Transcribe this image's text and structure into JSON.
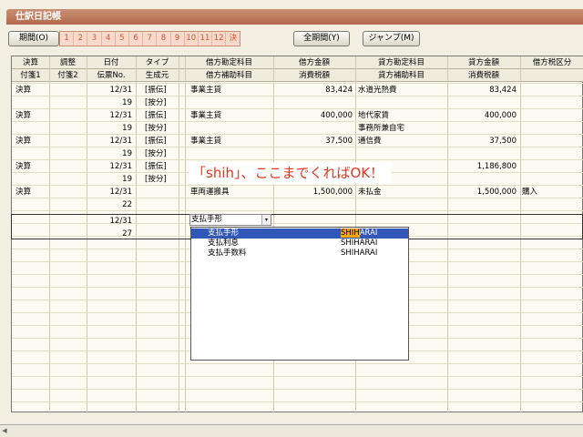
{
  "window_title": "仕訳日記帳",
  "toolbar": {
    "period_label": "期間(O)",
    "periods": [
      "1",
      "2",
      "3",
      "4",
      "5",
      "6",
      "7",
      "8",
      "9",
      "10",
      "11",
      "12",
      "決"
    ],
    "all_period_label": "全期間(Y)",
    "jump_label": "ジャンプ(M)"
  },
  "columns_top": [
    "決算",
    "調整",
    "日付",
    "タイプ",
    "借方勘定科目",
    "借方金額",
    "貸方勘定科目",
    "貸方金額",
    "借方税区分"
  ],
  "columns_bottom": [
    "付箋1",
    "付箋2",
    "伝票No.",
    "生成元",
    "借方補助科目",
    "消費税額",
    "貸方補助科目",
    "消費税額"
  ],
  "rows": [
    {
      "kessan": "決算",
      "date": "12/31",
      "no": "19",
      "type1": "[振伝]",
      "type2": "[按分]",
      "debit": "事業主貸",
      "debit_amt": "83,424",
      "credit": "水道光熱費",
      "credit_sub": "",
      "credit_amt": "83,424",
      "tax": ""
    },
    {
      "kessan": "決算",
      "date": "12/31",
      "no": "19",
      "type1": "[振伝]",
      "type2": "[按分]",
      "debit": "事業主貸",
      "debit_amt": "400,000",
      "credit": "地代家賃",
      "credit_sub": "事務所兼自宅",
      "credit_amt": "400,000",
      "tax": ""
    },
    {
      "kessan": "決算",
      "date": "12/31",
      "no": "19",
      "type1": "[振伝]",
      "type2": "[按分]",
      "debit": "事業主貸",
      "debit_amt": "37,500",
      "credit": "通信費",
      "credit_sub": "",
      "credit_amt": "37,500",
      "tax": ""
    },
    {
      "kessan": "決算",
      "date": "12/31",
      "no": "19",
      "type1": "[振伝]",
      "type2": "[按分]",
      "debit": "",
      "debit_amt": "",
      "credit": "",
      "credit_sub": "",
      "credit_amt": "1,186,800",
      "tax": ""
    },
    {
      "kessan": "決算",
      "date": "12/31",
      "no": "22",
      "type1": "",
      "type2": "",
      "debit": "車両運搬具",
      "debit_amt": "1,500,000",
      "credit": "未払金",
      "credit_sub": "",
      "credit_amt": "1,500,000",
      "tax": "購入"
    }
  ],
  "edit_row": {
    "date": "12/31",
    "no": "27",
    "combo_value": "支払手形"
  },
  "banner_text": "「shih」、ここまでくればOK！",
  "dropdown": {
    "items": [
      {
        "name": "支払手形",
        "kana_hl": "SHIH",
        "kana_rest": "ARAI",
        "kana": "SHIHARAI"
      },
      {
        "name": "支払利息",
        "kana": "SHIHARAI"
      },
      {
        "name": "支払手数料",
        "kana": "SHIHARAI"
      }
    ]
  },
  "colors": {
    "header": "#b3694b",
    "selection": "#3157b8",
    "highlight": "#ffa500",
    "banner_text": "#e8341c"
  }
}
